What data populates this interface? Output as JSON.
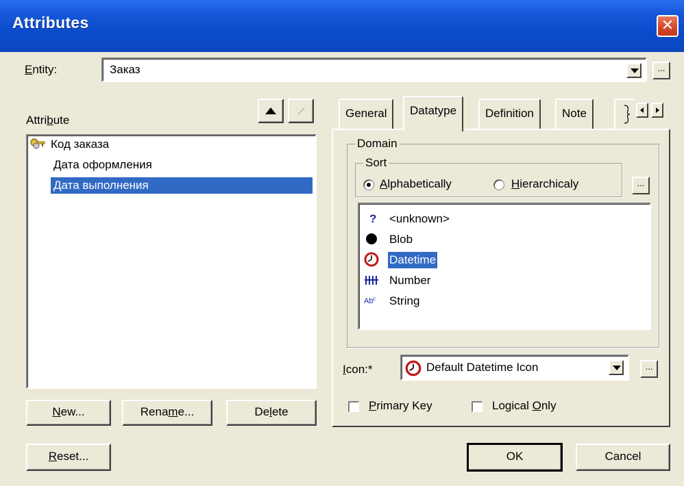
{
  "window": {
    "title": "Attributes",
    "close_glyph": "✕"
  },
  "entity": {
    "label_first": "E",
    "label_rest": "ntity:",
    "value": "Заказ",
    "ellipsis": "..."
  },
  "attribute": {
    "label_pre": "Attri",
    "label_u": "b",
    "label_post": "ute",
    "items": [
      {
        "label": "Код заказа",
        "icon": "key-icon",
        "selected": false
      },
      {
        "label": "Дата оформления",
        "icon": "",
        "selected": false
      },
      {
        "label": "Дата выполнения",
        "icon": "",
        "selected": true
      }
    ]
  },
  "buttons": {
    "new_u": "N",
    "new_rest": "ew...",
    "rename_pre": "Rena",
    "rename_u": "m",
    "rename_post": "e...",
    "delete_pre": "De",
    "delete_u": "l",
    "delete_post": "ete",
    "reset_u": "R",
    "reset_rest": "eset...",
    "ok": "OK",
    "cancel": "Cancel"
  },
  "tabs": {
    "items": [
      "General",
      "Datatype",
      "Definition",
      "Note"
    ],
    "active": "Datatype"
  },
  "domain": {
    "group_label": "Domain",
    "sort": {
      "group_label": "Sort",
      "alpha_u": "A",
      "alpha_rest": "lphabetically",
      "hier_u": "H",
      "hier_rest": "ierarchicaly",
      "selected": "Alphabetically",
      "ellipsis": "..."
    },
    "datatypes": [
      {
        "label": "<unknown>",
        "icon": "question-icon"
      },
      {
        "label": "Blob",
        "icon": "blob-icon"
      },
      {
        "label": "Datetime",
        "icon": "clock-icon",
        "selected": true
      },
      {
        "label": "Number",
        "icon": "number-icon"
      },
      {
        "label": "String",
        "icon": "string-icon"
      }
    ]
  },
  "icon_field": {
    "label_u": "I",
    "label_rest": "con:*",
    "value": "Default Datetime Icon",
    "ellipsis": "..."
  },
  "checks": {
    "primary_key_u": "P",
    "primary_key_rest": "rimary Key",
    "primary_key_checked": false,
    "logical_only_pre": "Logical ",
    "logical_only_u": "O",
    "logical_only_post": "nly",
    "logical_only_checked": false
  },
  "colors": {
    "selection": "#316ac5",
    "titlebar": "#0a4ccc",
    "face": "#ece9d8"
  }
}
